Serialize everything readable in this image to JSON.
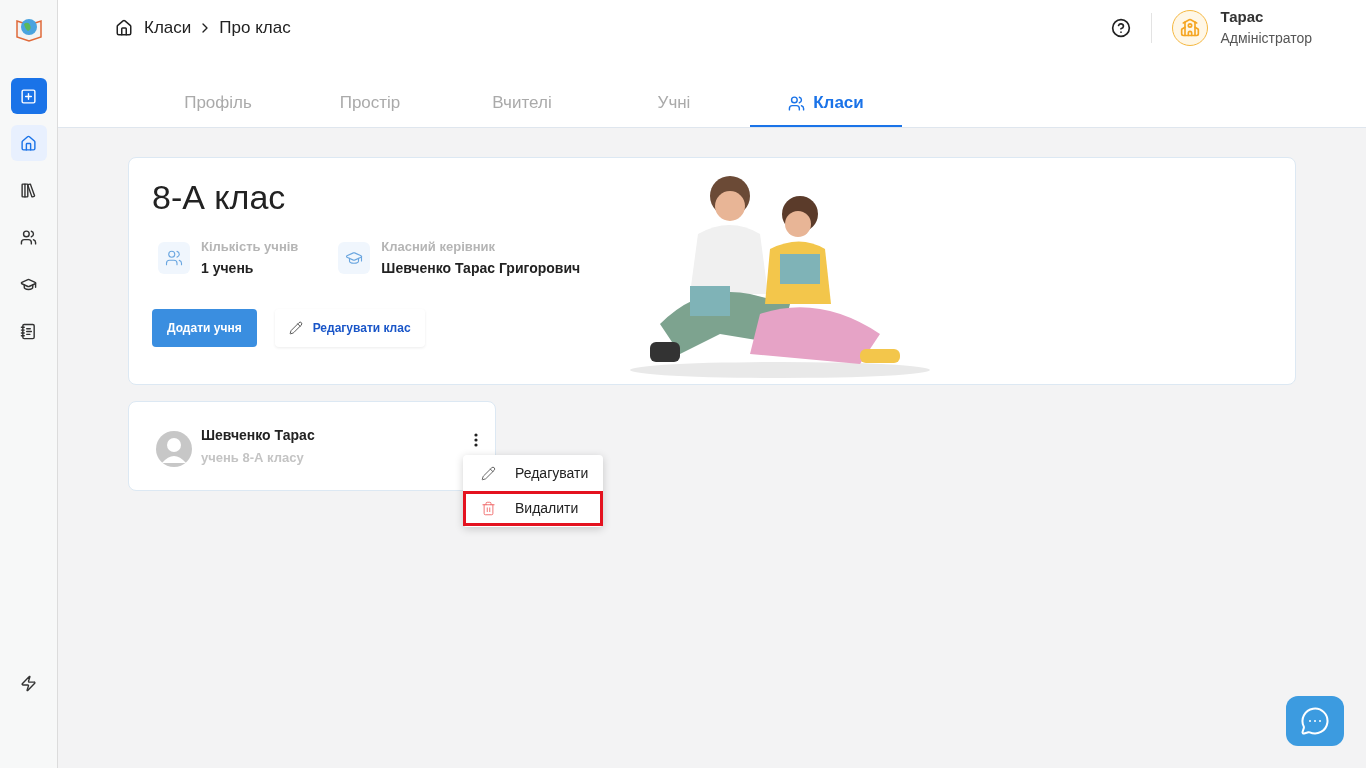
{
  "sidebar": {
    "items": [
      {
        "kind": "add"
      },
      {
        "kind": "home",
        "selected": true
      },
      {
        "kind": "library",
        "selected": false
      },
      {
        "kind": "people",
        "selected": false
      },
      {
        "kind": "graduation",
        "selected": false
      },
      {
        "kind": "journal",
        "selected": false
      }
    ]
  },
  "breadcrumb": [
    "Класи",
    "Про клас"
  ],
  "user": {
    "name": "Тарас",
    "role": "Адміністратор"
  },
  "tabs": [
    {
      "label": "Профіль",
      "selected": false,
      "kind": "plain"
    },
    {
      "label": "Простір",
      "selected": false,
      "kind": "plain"
    },
    {
      "label": "Вчителі",
      "selected": false,
      "kind": "plain"
    },
    {
      "label": "Учні",
      "selected": false,
      "kind": "plain"
    },
    {
      "label": "Класи",
      "selected": true,
      "kind": "people"
    }
  ],
  "class_card": {
    "title": "8-А клас",
    "stats": [
      {
        "kind": "people",
        "label": "Кількість учнів",
        "value": "1 учень"
      },
      {
        "kind": "graduation",
        "label": "Класний керівник",
        "value": "Шевченко Тарас Григорович"
      }
    ],
    "add_button": "Додати учня",
    "edit_button": "Редагувати клас"
  },
  "students": [
    {
      "name": "Шевченко Тарас",
      "subtitle": "учень 8-А класу"
    }
  ],
  "menu": {
    "items": [
      {
        "kind": "edit",
        "label": "Редагувати",
        "highlighted": false
      },
      {
        "kind": "delete",
        "label": "Видалити",
        "highlighted": true
      }
    ]
  }
}
